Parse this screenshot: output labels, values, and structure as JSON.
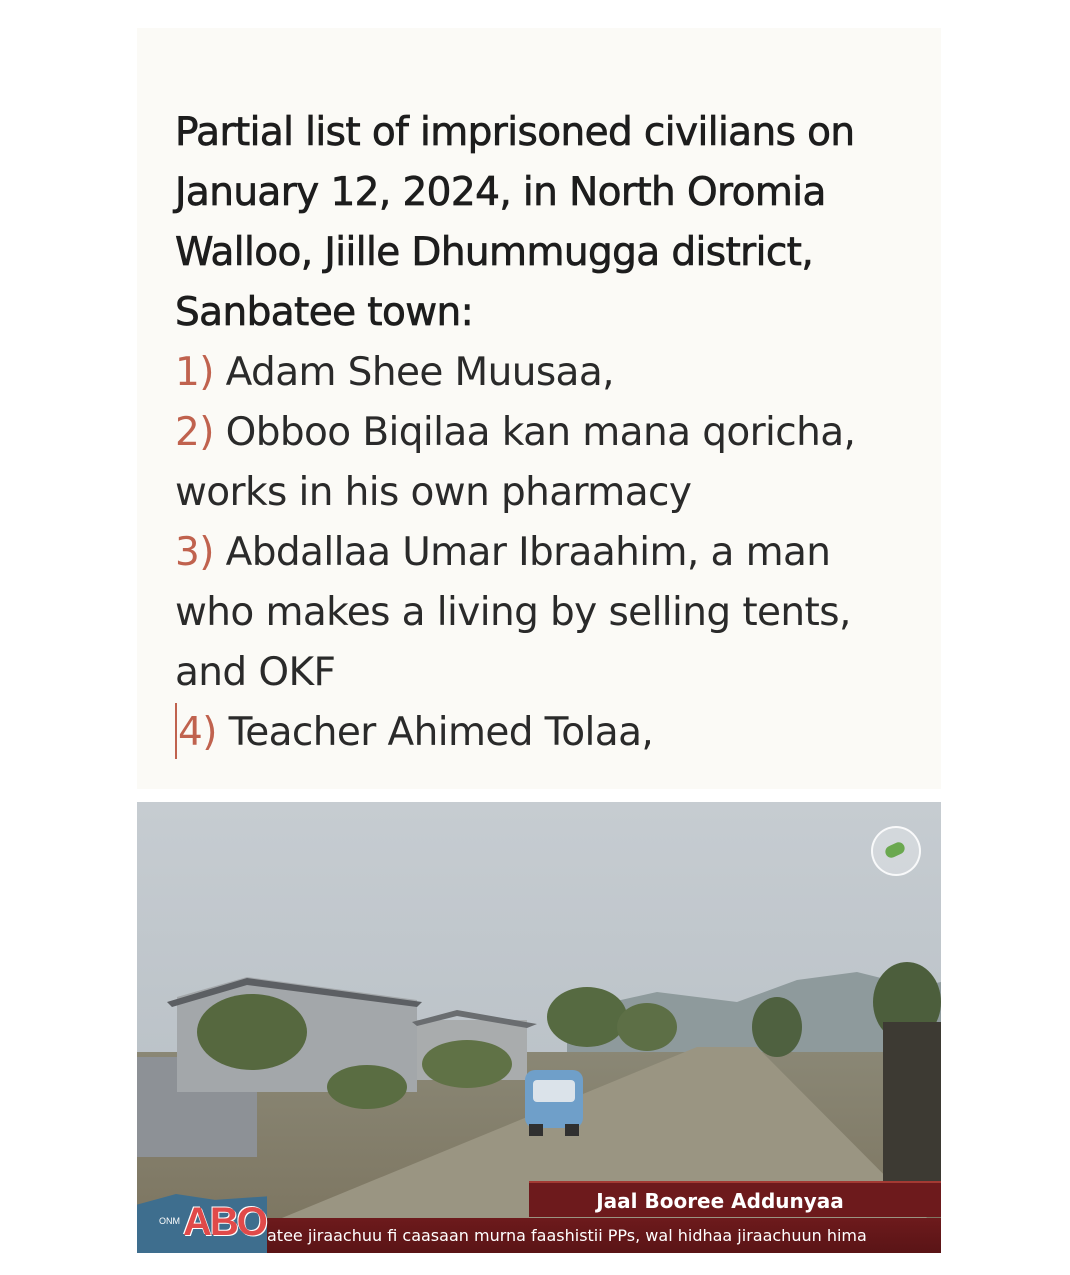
{
  "article": {
    "heading": "Partial list of imprisoned civilians on\nJanuary 12, 2024, in North Oromia\nWalloo, Jiille Dhummugga district,\nSanbatee town:",
    "items": [
      {
        "num": "1)",
        "text": " Adam Shee Muusaa,"
      },
      {
        "num": "2)",
        "text": " Obboo Biqilaa kan mana qoricha,\nworks in his own pharmacy"
      },
      {
        "num": "3)",
        "text": "  Abdallaa Umar Ibraahim, a man\nwho makes a living by selling tents,\nand OKF"
      },
      {
        "num": "4)",
        "text": "  Teacher Ahimed Tolaa,"
      }
    ]
  },
  "video": {
    "name_caption": "Jaal Booree Addunyaa",
    "ticker": "atee jiraachuu fi caasaan murna faashistii PPs, wal hidhaa jiraachuun hima",
    "logo_text": "ABO",
    "logo_small": "ONM",
    "colors": {
      "caption_bg": "#6d1a1c",
      "accent": "#c0624e"
    }
  }
}
